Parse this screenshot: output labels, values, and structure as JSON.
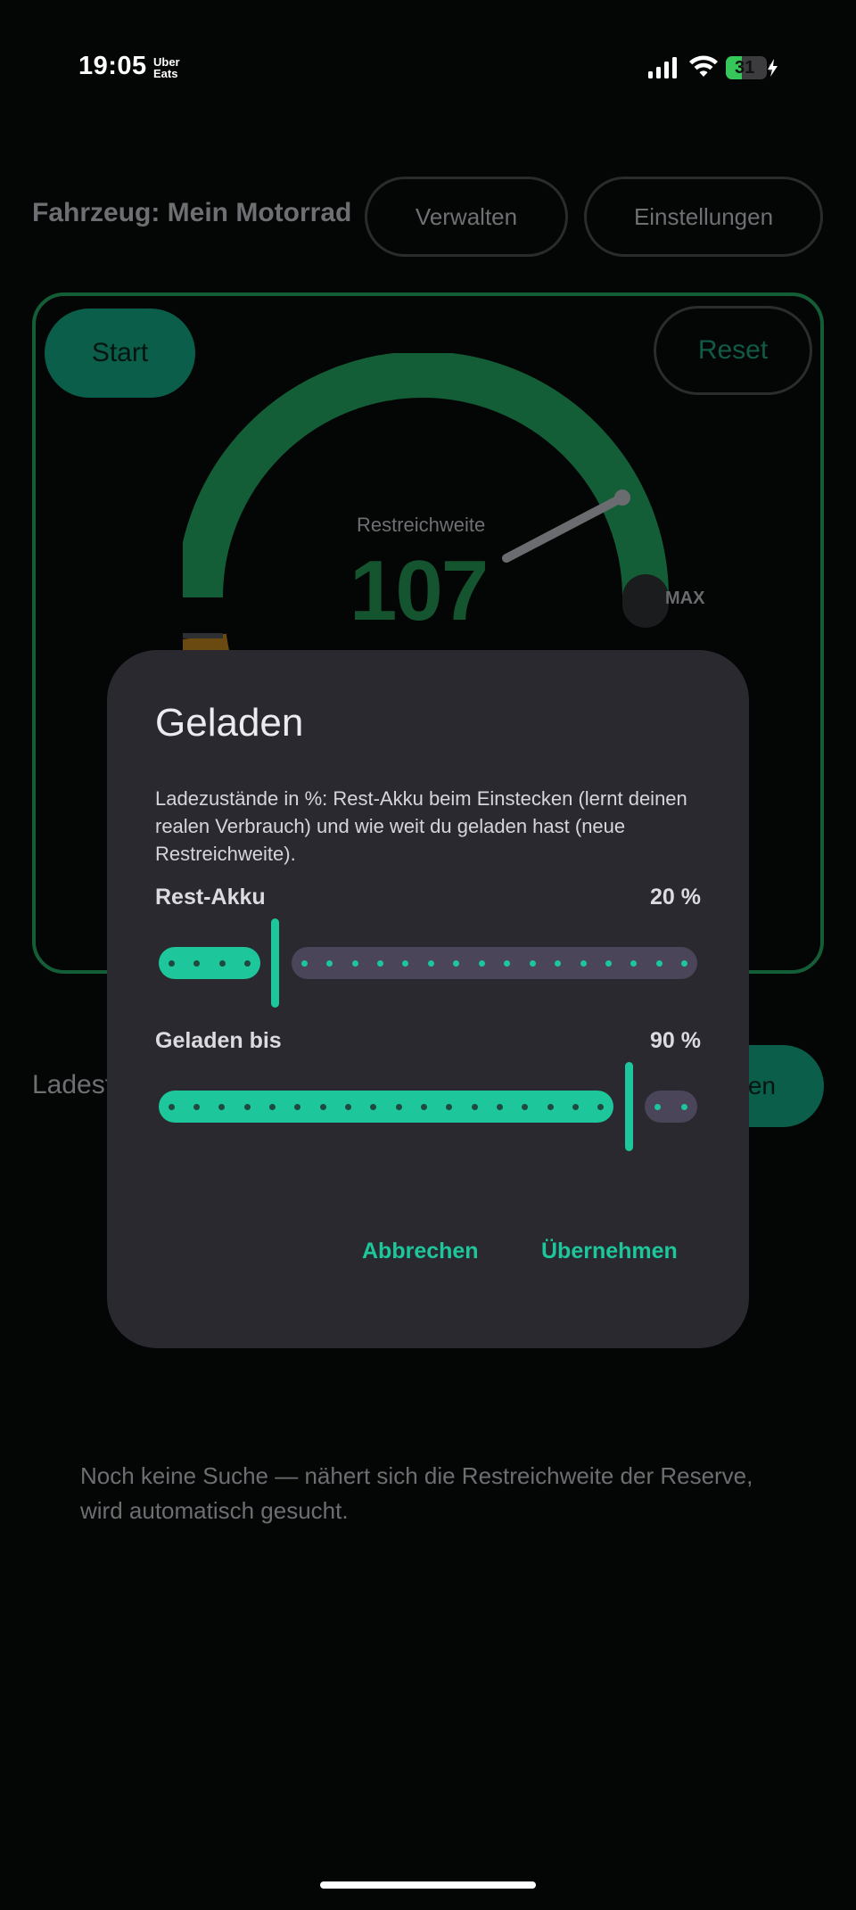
{
  "status_bar": {
    "time": "19:05",
    "app_badge_line1": "Uber",
    "app_badge_line2": "Eats",
    "battery_level": "31"
  },
  "header": {
    "vehicle_label": "Fahrzeug: Mein Motorrad",
    "manage_button": "Verwalten",
    "settings_button": "Einstellungen"
  },
  "gauge_card": {
    "start_button": "Start",
    "reset_button": "Reset",
    "range_label": "Restreichweite",
    "range_value": "107",
    "max_label": "MAX"
  },
  "background": {
    "ladest_partial": "Ladest",
    "pill_partial": "en",
    "footer_text": "Noch keine Suche — nähert sich die Restreichweite der Reserve, wird automatisch gesucht."
  },
  "dialog": {
    "title": "Geladen",
    "description": "Ladezustände in %: Rest-Akku beim Einstecken (lernt deinen realen Verbrauch) und wie weit du geladen hast (neue Restreichweite).",
    "slider_rest": {
      "label": "Rest-Akku",
      "value_text": "20 %",
      "value": 20
    },
    "slider_charged": {
      "label": "Geladen bis",
      "value_text": "90 %",
      "value": 90
    },
    "cancel_button": "Abbrechen",
    "apply_button": "Übernehmen"
  },
  "colors": {
    "accent": "#1ec69b",
    "gauge_green": "#135e37",
    "dialog_bg": "#2a292f"
  }
}
